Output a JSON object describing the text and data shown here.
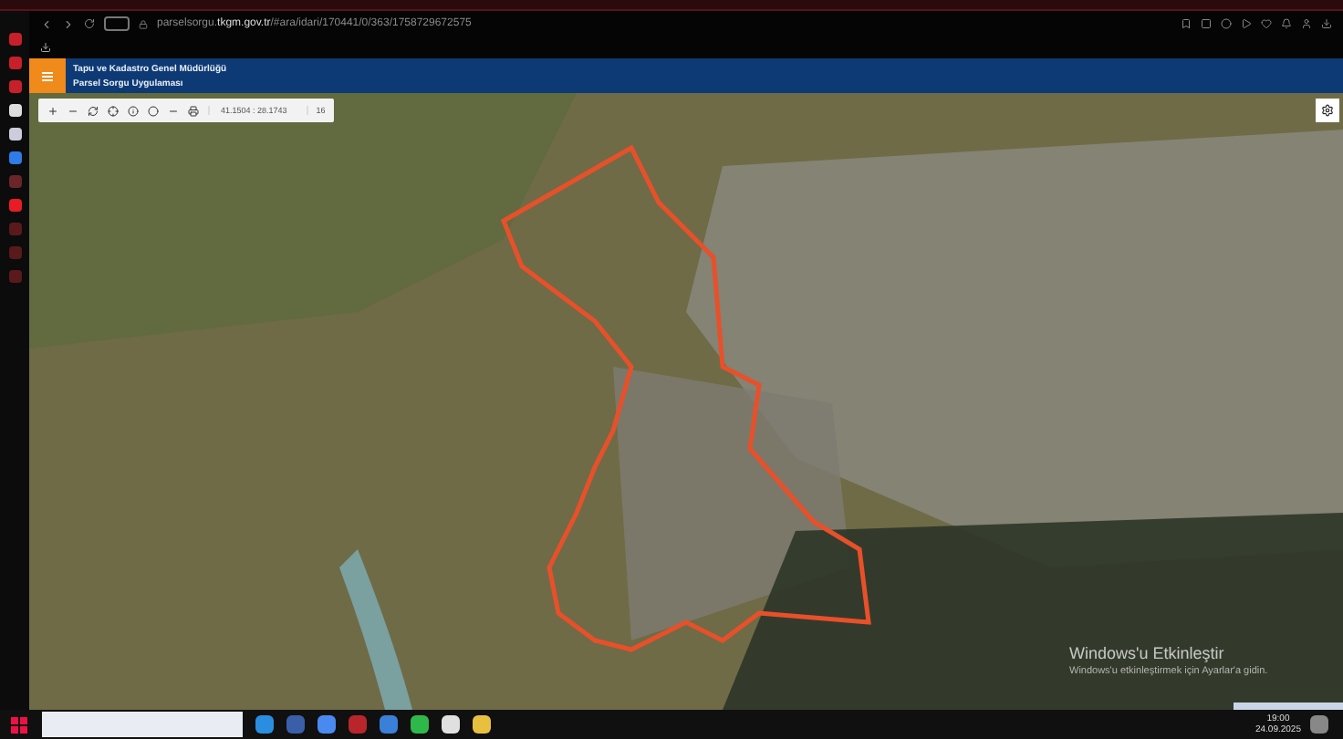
{
  "browser": {
    "url": "parselsorgu.**tkgm.gov.tr**/#ara/idari/170441/0/363/1758729672575"
  },
  "header": {
    "title": "Tapu ve Kadastro Genel Müdürlüğü",
    "subtitle": "Parsel Sorgu Uygulaması"
  },
  "map_toolbar": {
    "coordinates": "41.1504 : 28.1743",
    "zoom": "16"
  },
  "activation": {
    "title": "Windows'u Etkinleştir",
    "subtitle": "Windows'u etkinleştirmek için Ayarlar'a gidin."
  },
  "taskbar": {
    "time": "19:00",
    "date": "24.09.2025"
  }
}
